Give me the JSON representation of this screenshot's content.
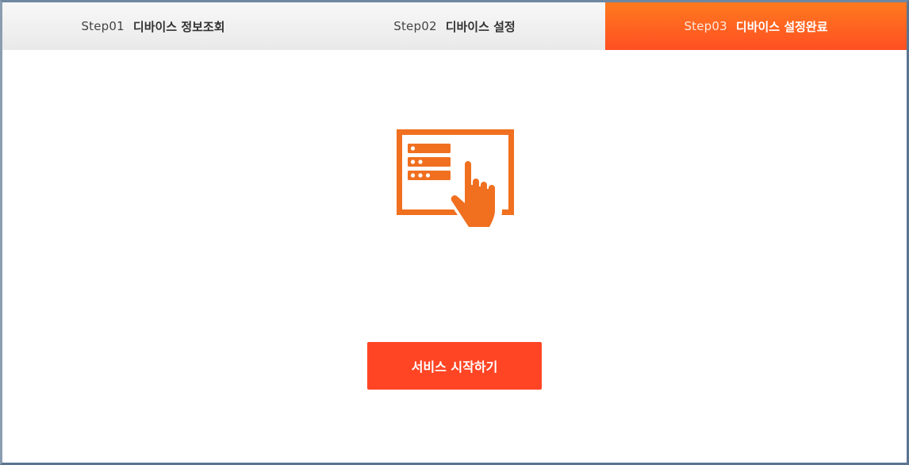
{
  "steps": [
    {
      "num": "Step01",
      "title": "디바이스 정보조회",
      "active": false
    },
    {
      "num": "Step02",
      "title": "디바이스 설정",
      "active": false
    },
    {
      "num": "Step03",
      "title": "디바이스 설정완료",
      "active": true
    }
  ],
  "main": {
    "icon": "device-touch-icon",
    "start_button_label": "서비스 시작하기"
  },
  "colors": {
    "accent": "#ff4524",
    "icon": "#f07020",
    "active_step_start": "#ff7a1e",
    "active_step_end": "#ff4f23"
  }
}
